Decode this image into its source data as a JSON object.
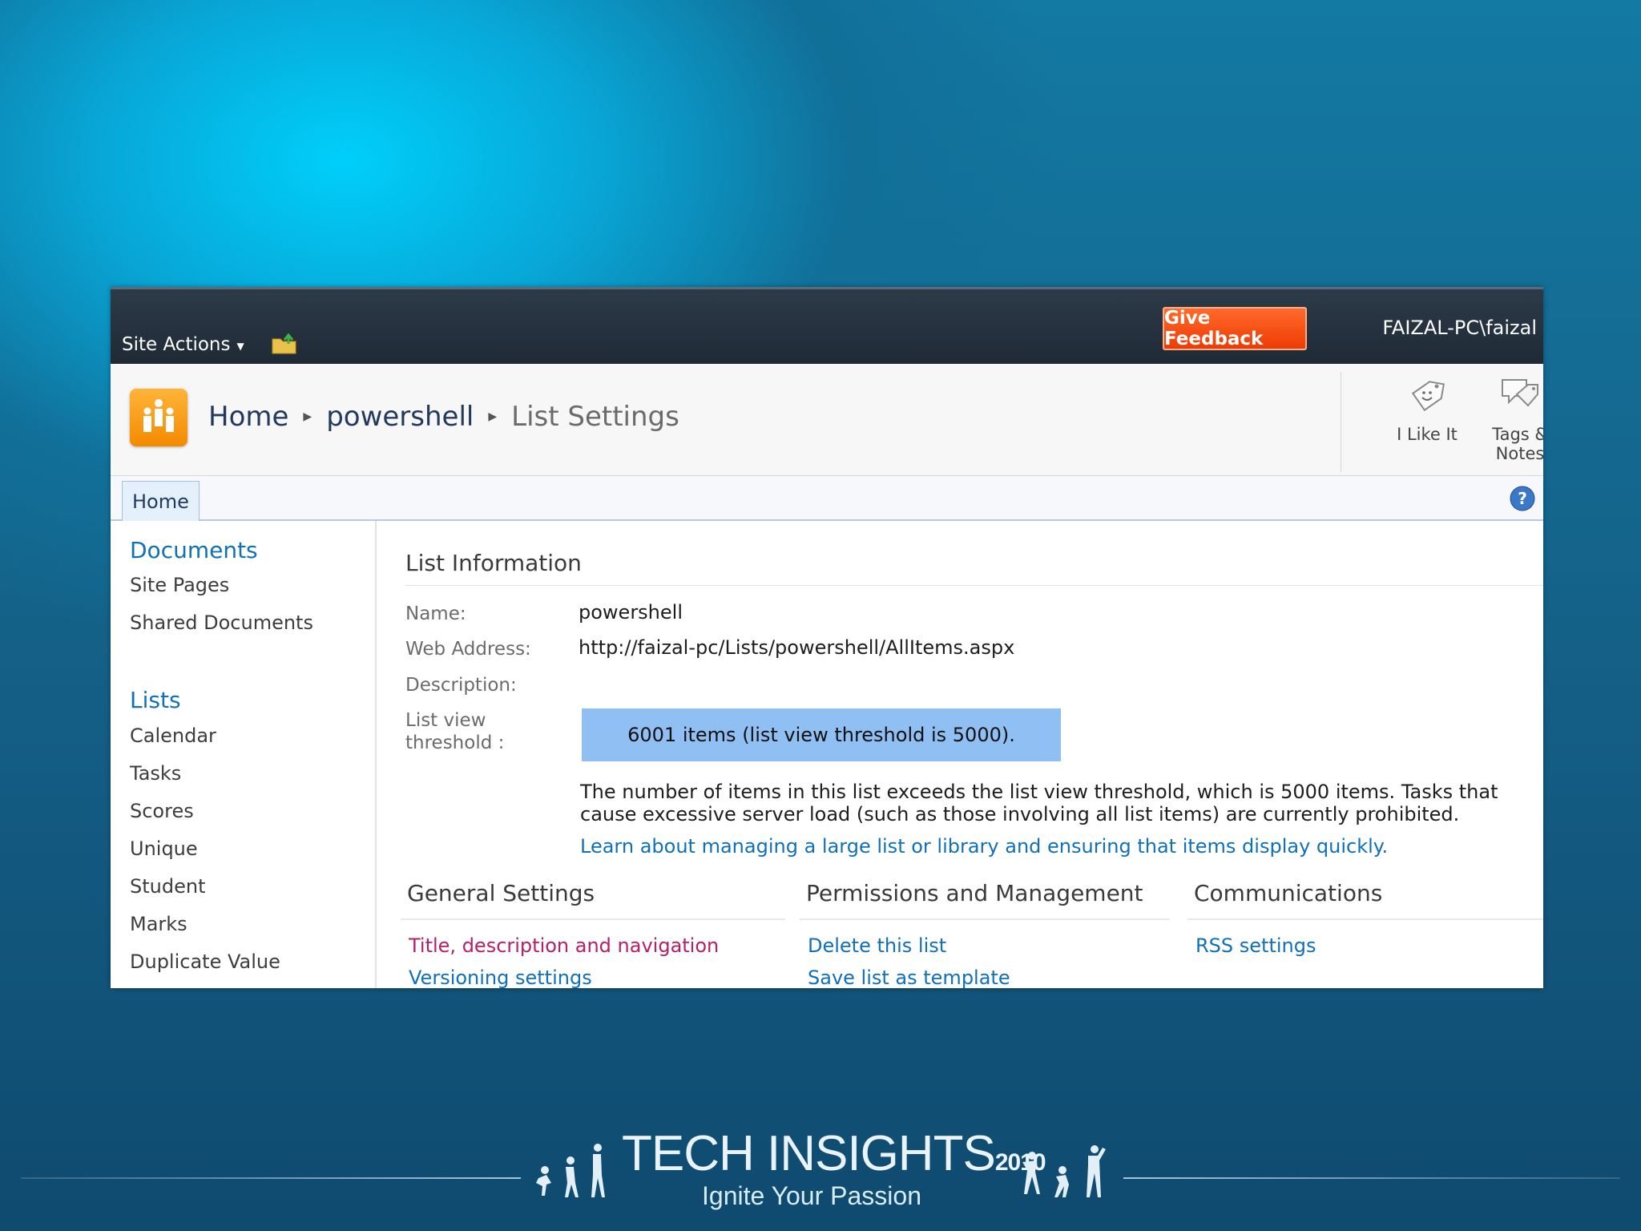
{
  "ribbon": {
    "site_actions_label": "Site Actions",
    "give_feedback_label": "Give Feedback",
    "user_name": "FAIZAL-PC\\faizal"
  },
  "breadcrumb": {
    "items": [
      "Home",
      "powershell",
      "List Settings"
    ]
  },
  "social": {
    "like_label": "I Like It",
    "tags_label_line1": "Tags &",
    "tags_label_line2": "Notes"
  },
  "topnav": {
    "home_tab": "Home"
  },
  "left_nav": {
    "documents_heading": "Documents",
    "documents_items": [
      "Site Pages",
      "Shared Documents"
    ],
    "lists_heading": "Lists",
    "lists_items": [
      "Calendar",
      "Tasks",
      "Scores",
      "Unique",
      "Student",
      "Marks",
      "Duplicate Value"
    ]
  },
  "list_info": {
    "title": "List Information",
    "name_label": "Name:",
    "name_value": "powershell",
    "web_address_label": "Web Address:",
    "web_address_value": "http://faizal-pc/Lists/powershell/AllItems.aspx",
    "description_label": "Description:",
    "threshold_label_line1": "List view",
    "threshold_label_line2": "threshold :",
    "threshold_value": "6001 items (list view threshold is 5000).",
    "threshold_message": "The number of items in this list exceeds the list view threshold, which is 5000 items. Tasks that cause excessive server load (such as those involving all list items) are currently prohibited.",
    "learn_link": "Learn about managing a large list or library and ensuring that items display quickly."
  },
  "sections": {
    "general": {
      "title": "General Settings",
      "links": [
        "Title, description and navigation",
        "Versioning settings"
      ]
    },
    "permissions": {
      "title": "Permissions and Management",
      "links": [
        "Delete this list",
        "Save list as template"
      ]
    },
    "communications": {
      "title": "Communications",
      "links": [
        "RSS settings"
      ]
    }
  },
  "footer": {
    "brand_name": "TECH INSIGHTS",
    "brand_year": "2010",
    "tagline": "Ignite Your Passion"
  },
  "colors": {
    "ribbon_bg": "#1f2a36",
    "feedback_orange": "#ee3b05",
    "link_blue": "#1070b8",
    "visited_link": "#b5206b",
    "threshold_highlight": "#8fbff3"
  }
}
